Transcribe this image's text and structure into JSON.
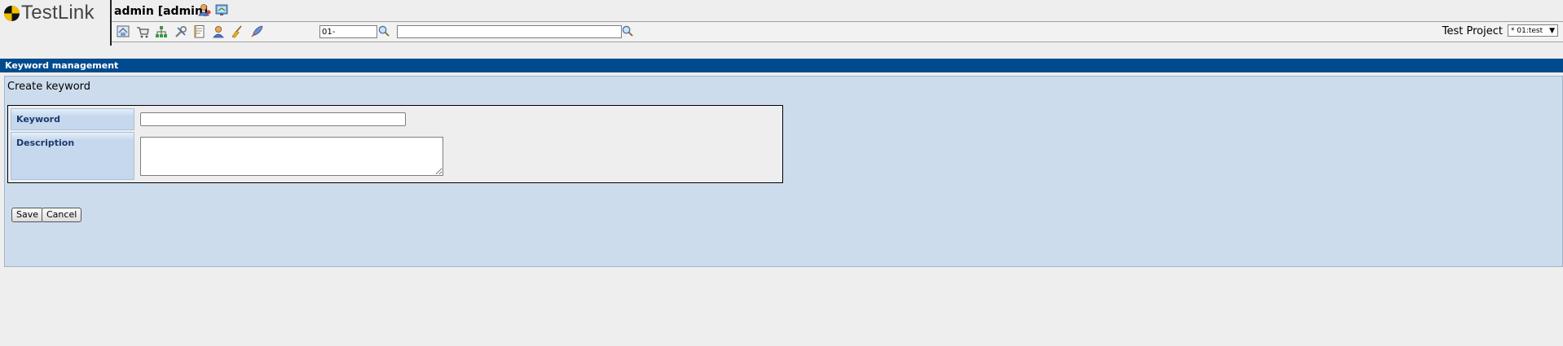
{
  "app": {
    "logo_text": "TestLink"
  },
  "header": {
    "user": "admin [admin]",
    "icons": [
      "user-settings-icon",
      "logout-icon"
    ]
  },
  "toolbar": {
    "icons": [
      "home-icon",
      "cart-icon",
      "tree-icon",
      "tools-icon",
      "document-icon",
      "user-icon",
      "broom-icon",
      "rocket-icon"
    ],
    "testcase_prefix_value": "01-",
    "search_value": "",
    "test_project_label": "Test Project",
    "test_project_selected": "* 01:test"
  },
  "page": {
    "title": "Keyword management",
    "section_title": "Create keyword",
    "form": {
      "keyword_label": "Keyword",
      "keyword_value": "",
      "description_label": "Description",
      "description_value": ""
    },
    "buttons": {
      "save": "Save",
      "cancel": "Cancel"
    }
  },
  "colors": {
    "title_bar": "#004b8d",
    "work_area": "#cddced",
    "label_cell": "#c6d8ee"
  }
}
